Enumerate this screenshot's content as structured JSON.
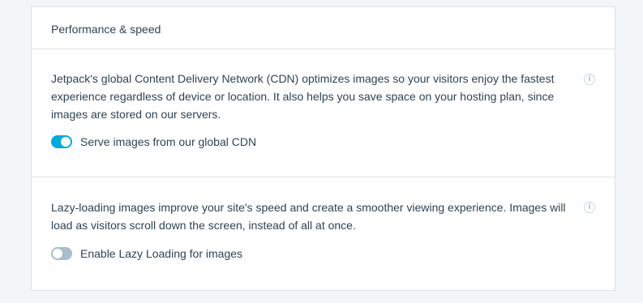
{
  "card": {
    "title": "Performance & speed"
  },
  "cdn": {
    "description": "Jetpack's global Content Delivery Network (CDN) optimizes images so your visitors enjoy the fastest experience regardless of device or location. It also helps you save space on your hosting plan, since images are stored on our servers.",
    "toggle_label": "Serve images from our global CDN",
    "toggle_state": "on",
    "info_icon": "i"
  },
  "lazy": {
    "description": "Lazy-loading images improve your site's speed and create a smoother viewing experience. Images will load as visitors scroll down the screen, instead of all at once.",
    "toggle_label": "Enable Lazy Loading for images",
    "toggle_state": "off",
    "info_icon": "i"
  },
  "colors": {
    "accent": "#00aadc",
    "toggle_off": "#a8bece",
    "text": "#2e4453",
    "border": "#dbe2e7",
    "background": "#f3f6f8"
  }
}
